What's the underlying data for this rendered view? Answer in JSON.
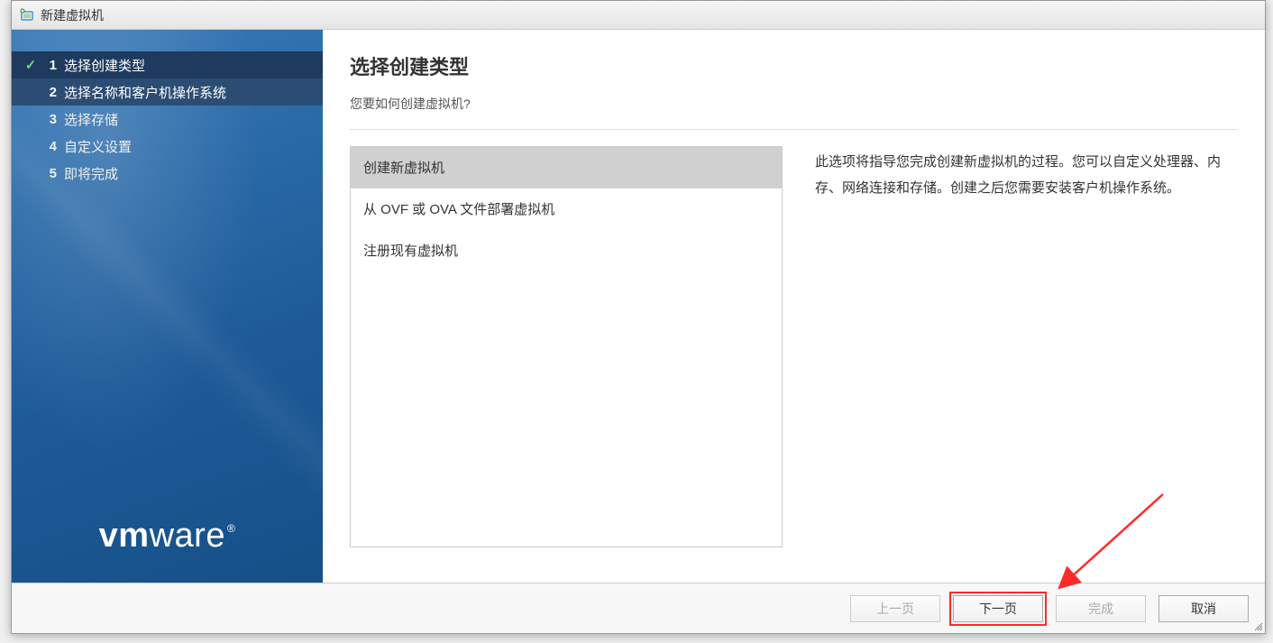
{
  "dialog": {
    "title": "新建虚拟机"
  },
  "steps": [
    {
      "num": "1",
      "label": "选择创建类型",
      "state": "completed"
    },
    {
      "num": "2",
      "label": "选择名称和客户机操作系统",
      "state": "active"
    },
    {
      "num": "3",
      "label": "选择存储",
      "state": "pending"
    },
    {
      "num": "4",
      "label": "自定义设置",
      "state": "pending"
    },
    {
      "num": "5",
      "label": "即将完成",
      "state": "pending"
    }
  ],
  "brand": {
    "part1": "vm",
    "part2": "ware",
    "reg": "®"
  },
  "content": {
    "title": "选择创建类型",
    "subtitle": "您要如何创建虚拟机?",
    "options": [
      {
        "label": "创建新虚拟机",
        "selected": true
      },
      {
        "label": "从 OVF 或 OVA 文件部署虚拟机",
        "selected": false
      },
      {
        "label": "注册现有虚拟机",
        "selected": false
      }
    ],
    "description": "此选项将指导您完成创建新虚拟机的过程。您可以自定义处理器、内存、网络连接和存储。创建之后您需要安装客户机操作系统。"
  },
  "footer": {
    "back": "上一页",
    "next": "下一页",
    "finish": "完成",
    "cancel": "取消"
  }
}
